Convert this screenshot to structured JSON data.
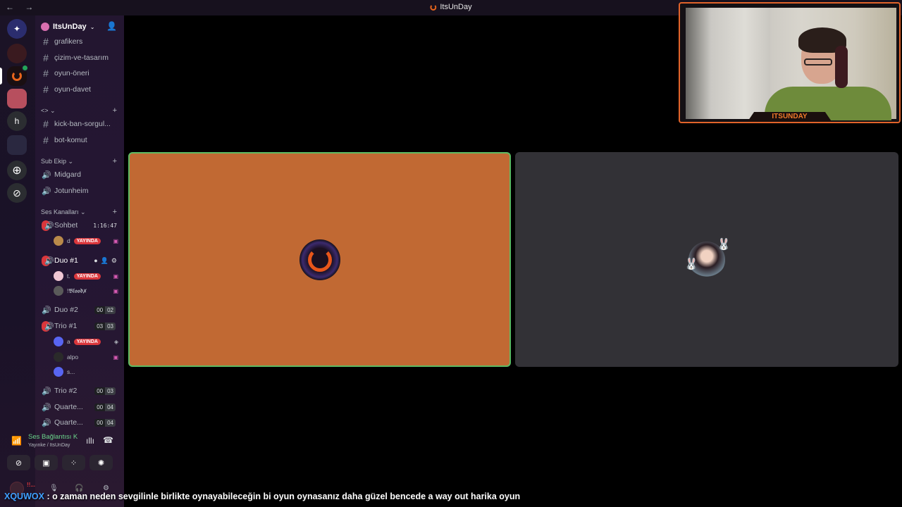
{
  "window": {
    "title": "ItsUnDay",
    "nav": "← →"
  },
  "server": {
    "name": "ItsUnDay",
    "invite_icon": "add-member-icon"
  },
  "text_channels": [
    "grafikers",
    "çizim-ve-tasarım",
    "oyun-öneri",
    "oyun-davet"
  ],
  "category_code": {
    "label": "<> ⌄",
    "channels": [
      "kick-ban-sorgul...",
      "bot-komut"
    ]
  },
  "category_sub": {
    "label": "Sub Ekip ⌄",
    "channels": [
      "Midgard",
      "Jotunheim"
    ]
  },
  "category_voice": {
    "label": "Ses Kanalları ⌄"
  },
  "voice": {
    "sohbet": {
      "name": "Sohbet",
      "timer": "1:16:47",
      "users": [
        {
          "name": "d",
          "badge": "YAYINDA"
        }
      ]
    },
    "duo1": {
      "name": "Duo #1",
      "users": [
        {
          "name": "t.",
          "badge": "YAYINDA"
        },
        {
          "name": "!𝕭𝖑𝖔𝖔𝖉✗"
        }
      ]
    },
    "duo2": {
      "name": "Duo #2",
      "a": "00",
      "b": "02"
    },
    "trio1": {
      "name": "Trio #1",
      "a": "03",
      "b": "03",
      "users": [
        {
          "name": "a",
          "badge": "YAYINDA"
        },
        {
          "name": "alpo"
        },
        {
          "name": "s..."
        }
      ]
    },
    "trio2": {
      "name": "Trio #2",
      "a": "00",
      "b": "03"
    },
    "quarte1": {
      "name": "Quarte...",
      "a": "00",
      "b": "04"
    },
    "quarte2": {
      "name": "Quarte...",
      "a": "00",
      "b": "04"
    }
  },
  "voice_panel": {
    "status": "Ses Bağlantısı Kuruldu",
    "where": "Yayınke / ItsUnDay"
  },
  "user_bar": {
    "name": "!!..."
  },
  "webcam": {
    "plate": "ITSUNDAY"
  },
  "chat": {
    "user": "XQUWOX",
    "message": ": o zaman neden sevgilinle birlikte oynayabileceğin bi oyun oynasanız daha güzel bencede a way out harika oyun"
  },
  "colors": {
    "accent": "#5dbb63",
    "live": "#da373c",
    "tile_orange": "#c16933",
    "tile_gray": "#323136"
  }
}
